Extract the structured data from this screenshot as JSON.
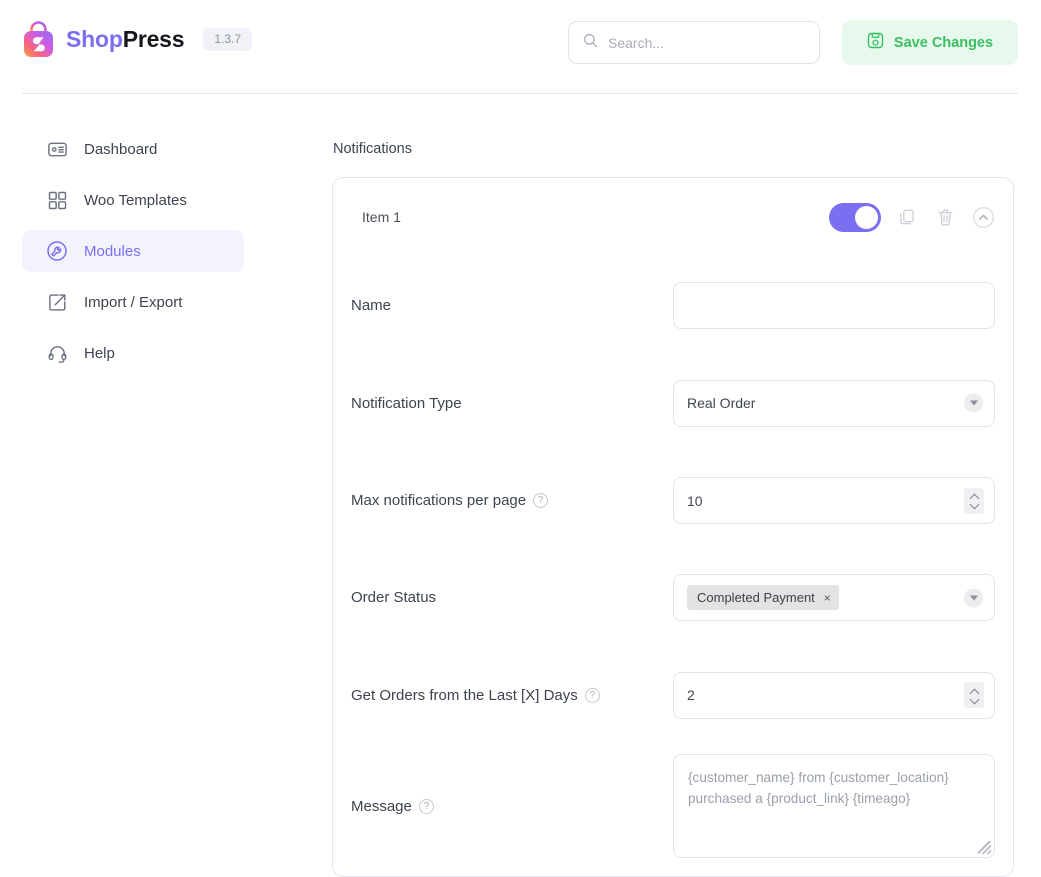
{
  "header": {
    "brand_shop": "Shop",
    "brand_press": "Press",
    "version": "1.3.7",
    "logo_icon": "shopping-bag-icon",
    "search": {
      "icon": "search-icon",
      "placeholder": "Search...",
      "value": ""
    },
    "save_button": {
      "label": "Save Changes",
      "icon": "save-disk-icon",
      "bg_color": "#e7f9ed",
      "text_color": "#3bbf62"
    }
  },
  "sidebar": {
    "items": [
      {
        "label": "Dashboard",
        "icon": "dashboard-card-icon",
        "active": false
      },
      {
        "label": "Woo Templates",
        "icon": "grid-squares-icon",
        "active": false
      },
      {
        "label": "Modules",
        "icon": "wrench-circle-icon",
        "active": true
      },
      {
        "label": "Import / Export",
        "icon": "export-box-icon",
        "active": false
      },
      {
        "label": "Help",
        "icon": "headset-icon",
        "active": false
      }
    ],
    "active_bg": "#f3f3fd",
    "active_color": "#7b6ef0"
  },
  "main": {
    "section_title": "Notifications",
    "card": {
      "item_title": "Item 1",
      "toggle": {
        "state": "on",
        "color": "#7b6ef0"
      },
      "actions": [
        {
          "name": "duplicate-icon"
        },
        {
          "name": "trash-icon"
        },
        {
          "name": "chevron-up-circle-icon"
        }
      ],
      "fields": [
        {
          "label": "Name",
          "help": false,
          "type": "text",
          "value": "",
          "placeholder": ""
        },
        {
          "label": "Notification Type",
          "help": false,
          "type": "select",
          "value": "Real Order"
        },
        {
          "label": "Max notifications per page",
          "help": true,
          "help_glyph": "?",
          "type": "number",
          "value": "10"
        },
        {
          "label": "Order Status",
          "help": false,
          "type": "multiselect",
          "chip": "Completed Payment",
          "chip_remove": "×"
        },
        {
          "label": "Get Orders from the Last [X] Days",
          "help": true,
          "help_glyph": "?",
          "type": "number",
          "value": "2"
        },
        {
          "label": "Message",
          "help": true,
          "help_glyph": "?",
          "type": "textarea",
          "value": "{customer_name} from {customer_location} purchased a {product_link} {timeago}"
        }
      ]
    }
  }
}
